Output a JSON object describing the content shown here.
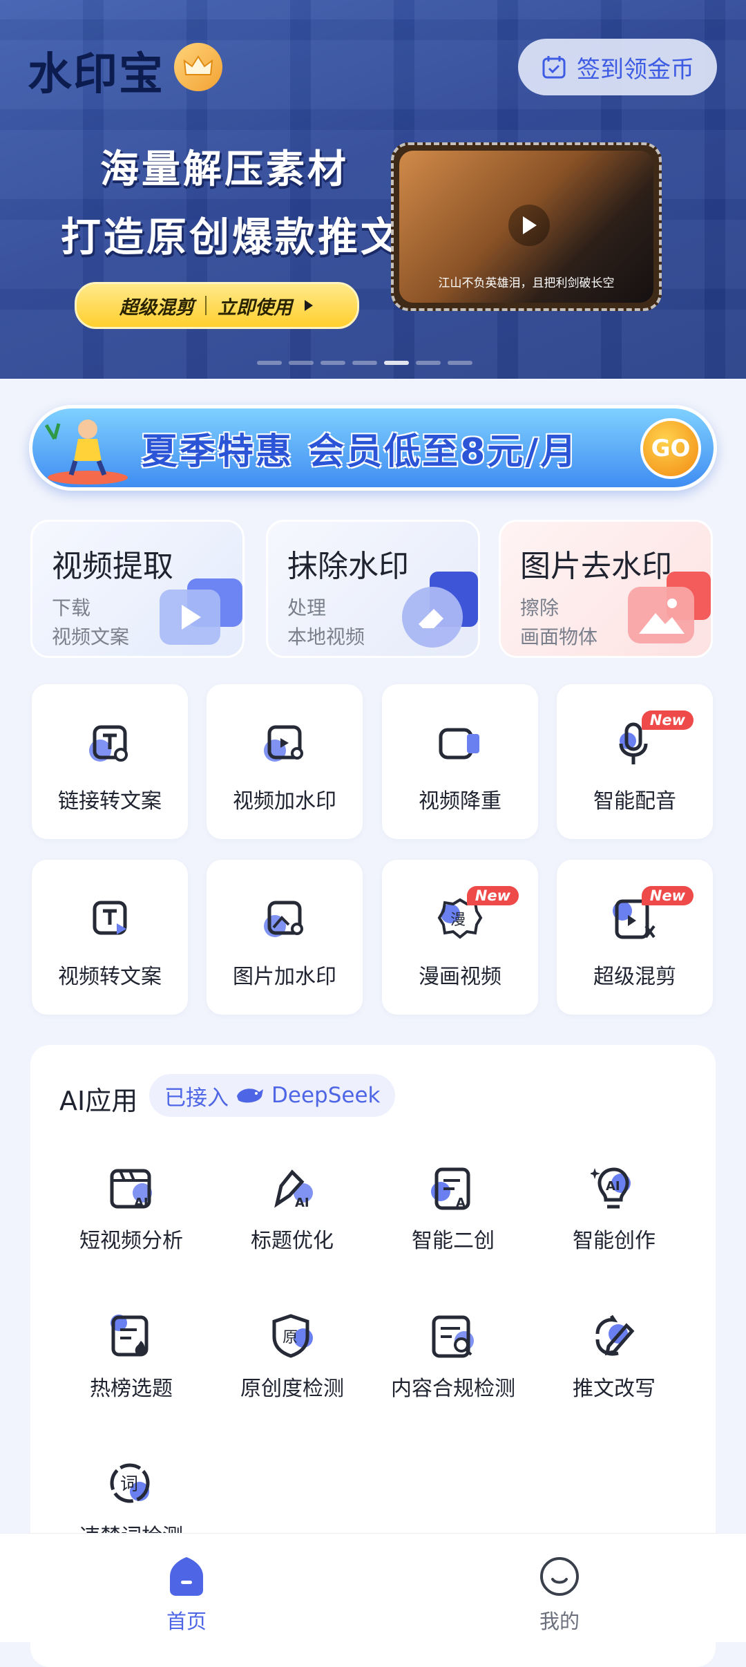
{
  "app": {
    "logo_text": "水印宝",
    "checkin_label": "签到领金币"
  },
  "hero": {
    "line1": "海量解压素材",
    "line2": "打造原创爆款推文",
    "cta_left": "超级混剪",
    "cta_right": "立即使用",
    "video_caption": "江山不负英雄泪，且把利剑破长空",
    "carousel_count": 7,
    "carousel_active_index": 4
  },
  "summer_banner": {
    "text": "夏季特惠 会员低至8元/月",
    "go_label": "GO"
  },
  "big_cards": [
    {
      "title": "视频提取",
      "line1": "下载",
      "line2": "视频文案"
    },
    {
      "title": "抹除水印",
      "line1": "处理",
      "line2": "本地视频"
    },
    {
      "title": "图片去水印",
      "line1": "擦除",
      "line2": "画面物体"
    }
  ],
  "tools": [
    {
      "label": "链接转文案",
      "icon": "link-text-icon",
      "new": ""
    },
    {
      "label": "视频加水印",
      "icon": "video-watermark-icon",
      "new": ""
    },
    {
      "label": "视频降重",
      "icon": "video-camera-icon",
      "new": ""
    },
    {
      "label": "智能配音",
      "icon": "microphone-icon",
      "new": "New"
    },
    {
      "label": "视频转文案",
      "icon": "video-text-icon",
      "new": ""
    },
    {
      "label": "图片加水印",
      "icon": "image-watermark-icon",
      "new": ""
    },
    {
      "label": "漫画视频",
      "icon": "comic-video-icon",
      "new": "New"
    },
    {
      "label": "超级混剪",
      "icon": "super-mix-icon",
      "new": "New"
    }
  ],
  "ai_section": {
    "title": "AI应用",
    "chip_prefix": "已接入",
    "chip_brand": "DeepSeek",
    "items": [
      {
        "label": "短视频分析",
        "icon": "video-analysis-icon"
      },
      {
        "label": "标题优化",
        "icon": "pen-ai-icon"
      },
      {
        "label": "智能二创",
        "icon": "doc-ai-icon"
      },
      {
        "label": "智能创作",
        "icon": "bulb-ai-icon"
      },
      {
        "label": "热榜选题",
        "icon": "hot-list-icon"
      },
      {
        "label": "原创度检测",
        "icon": "original-check-icon"
      },
      {
        "label": "内容合规检测",
        "icon": "compliance-check-icon"
      },
      {
        "label": "推文改写",
        "icon": "rewrite-icon"
      },
      {
        "label": "违禁词检测",
        "icon": "forbidden-word-icon"
      }
    ]
  },
  "tabbar": {
    "tabs": [
      {
        "label": "首页",
        "icon": "home-icon",
        "active": true
      },
      {
        "label": "我的",
        "icon": "profile-icon",
        "active": false
      }
    ]
  },
  "colors": {
    "accent": "#4e66e6",
    "hero_bg": "#2c4696",
    "new_badge": "#ef4a4a"
  }
}
